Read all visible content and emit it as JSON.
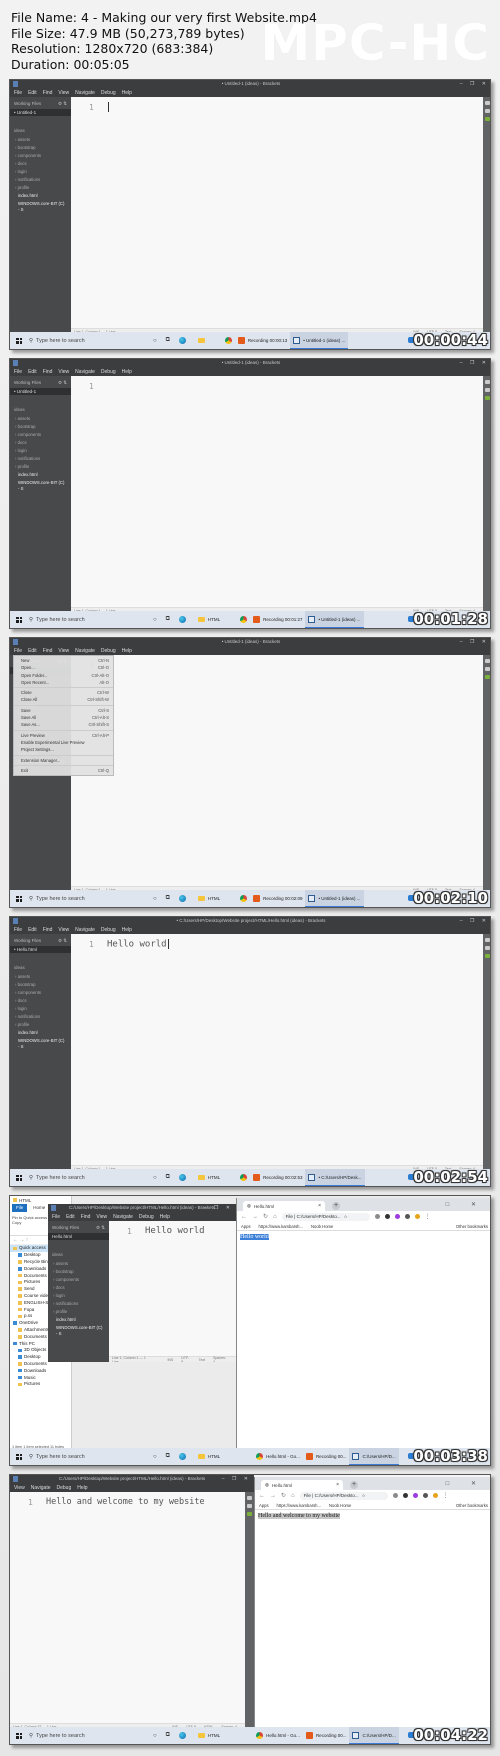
{
  "header": {
    "file_name": "File Name: 4 - Making our very first Website.mp4",
    "file_size": "File Size: 47.9 MB (50,273,789 bytes)",
    "resolution": "Resolution: 1280x720 (683:384)",
    "duration": "Duration: 00:05:05",
    "brand": "MPC-HC"
  },
  "common": {
    "menu": [
      "File",
      "Edit",
      "Find",
      "View",
      "Navigate",
      "Debug",
      "Help"
    ],
    "working_files": "Working Files",
    "folder": "ideas",
    "tree": [
      "assets",
      "bootstrap",
      "components",
      "docs",
      "login",
      "notifications",
      "profile"
    ],
    "tree_files": [
      "index.html",
      "WINDOWS.core-BIT (C) - S"
    ],
    "line_number": "1",
    "status_left": "Line 1, Column 1 — 1 Line",
    "status_right": [
      "INS",
      "UTF-8",
      "Text",
      "Spaces: 4"
    ],
    "taskbar_search": "Type here to search",
    "taskbar_folder": "HTML",
    "win_controls": "– ❐ ✕"
  },
  "frames": [
    {
      "timestamp": "00:00:44",
      "title": "• Untitled-1 (ideas) - Brackets",
      "active_file": "• Untitled-1",
      "code": "",
      "tasks": [
        "Recording 00:00:13",
        "• Untitled-1 (ideas) ..."
      ]
    },
    {
      "timestamp": "00:01:28",
      "title": "• Untitled-1 (ideas) - Brackets",
      "active_file": "• Untitled-1",
      "code": "",
      "tasks": [
        "Recording 00:01:27",
        "• Untitled-1 (ideas) ..."
      ]
    },
    {
      "timestamp": "00:02:10",
      "title": "• Untitled-1 (ideas) - Brackets",
      "active_file": "• Untitled-1",
      "code": "",
      "tasks": [
        "Recording 00:02:09",
        "• Untitled-1 (ideas) ..."
      ],
      "file_menu": [
        {
          "label": "New",
          "shortcut": "Ctrl-N"
        },
        {
          "label": "Open...",
          "shortcut": "Ctrl-O"
        },
        {
          "label": "Open Folder...",
          "shortcut": "Ctrl-Alt-O"
        },
        {
          "label": "Open Recent...",
          "shortcut": "Alt-O"
        },
        {
          "label": "Close",
          "shortcut": "Ctrl-W"
        },
        {
          "label": "Close All",
          "shortcut": "Ctrl-Shift-W"
        },
        {
          "label": "Save",
          "shortcut": "Ctrl-S"
        },
        {
          "label": "Save All",
          "shortcut": "Ctrl-Alt-S"
        },
        {
          "label": "Save As...",
          "shortcut": "Ctrl-Shift-S"
        },
        {
          "label": "Live Preview",
          "shortcut": "Ctrl-Alt-P"
        },
        {
          "label": "Enable Experimental Live Preview",
          "shortcut": ""
        },
        {
          "label": "Project Settings...",
          "shortcut": ""
        },
        {
          "label": "Extension Manager...",
          "shortcut": ""
        },
        {
          "label": "Exit",
          "shortcut": "Ctrl-Q"
        }
      ]
    },
    {
      "timestamp": "00:02:54",
      "title": "• C:/Users/HP/Desktop/Website project/HTML/Hello.html (ideas) - Brackets",
      "active_file": "• Hello.html",
      "code": "Hello world",
      "tasks": [
        "Recording 00:02:53",
        "• C:/Users/HP/Desk..."
      ]
    },
    {
      "timestamp": "00:03:38",
      "title": "C:/Users/HP/Desktop/Website project/HTML/Hello.html (ideas) - Brackets",
      "active_file": "Hello.html",
      "code": "Hello world",
      "tasks": [
        "Hello.html - Go...",
        "Recording 00...",
        "C:/Users/HP/D..."
      ],
      "explorer": {
        "title": "HTML",
        "tabs": [
          "File",
          "Home"
        ],
        "ribbon": [
          "Pin to Quick access",
          "Copy"
        ],
        "nav": "← → ↑",
        "items": [
          {
            "label": "Quick access",
            "icon": "star",
            "top": true,
            "selected": true
          },
          {
            "label": "Desktop",
            "icon": "blue"
          },
          {
            "label": "Recycle Bin",
            "icon": "grey"
          },
          {
            "label": "Downloads",
            "icon": "blue"
          },
          {
            "label": "Documents",
            "icon": "grey"
          },
          {
            "label": "Pictures",
            "icon": "grey"
          },
          {
            "label": "Send",
            "icon": "folder"
          },
          {
            "label": "Course videos",
            "icon": "folder"
          },
          {
            "label": "ENGLISH-S",
            "icon": "folder"
          },
          {
            "label": "Fopa",
            "icon": "folder"
          },
          {
            "label": "p.ss",
            "icon": "folder"
          },
          {
            "label": "OneDrive",
            "icon": "blue",
            "top": true
          },
          {
            "label": "Attachments",
            "icon": "folder"
          },
          {
            "label": "Documents",
            "icon": "folder"
          },
          {
            "label": "This PC",
            "icon": "blue",
            "top": true
          },
          {
            "label": "3D Objects",
            "icon": "blue"
          },
          {
            "label": "Desktop",
            "icon": "blue"
          },
          {
            "label": "Documents",
            "icon": "grey"
          },
          {
            "label": "Downloads",
            "icon": "blue"
          },
          {
            "label": "Music",
            "icon": "blue"
          },
          {
            "label": "Pictures",
            "icon": "grey"
          }
        ],
        "status": "1 item    1 item selected  11 bytes"
      },
      "browser": {
        "tab_title": "Hello.html",
        "address": "File | C:/Users/HP/Deskto...",
        "bookmarks": [
          "Apps",
          "https://www.kambarsh...",
          "Noob Home"
        ],
        "other_bookmarks": "Other bookmarks",
        "content": "Hello world"
      }
    },
    {
      "timestamp": "00:04:22",
      "title": "C:/Users/HP/Desktop/Website project/HTML/Hello.html (ideas) - Brackets",
      "menu_partial": [
        "View",
        "Navigate",
        "Debug",
        "Help"
      ],
      "code": "Hello and welcome to my website",
      "status_left": "Line 1, Column 32 — 1 Line",
      "status_right": [
        "INS",
        "UTF-8",
        "HTML",
        "Spaces: 4"
      ],
      "tasks": [
        "Hello.html - Go...",
        "Recording 00...",
        "C:/Users/HP/D..."
      ],
      "browser": {
        "tab_title": "Hello.html",
        "address": "File | C:/Users/HP/Deskto...",
        "bookmarks": [
          "Apps",
          "https://www.kambarsh...",
          "Noob Home"
        ],
        "other_bookmarks": "Other bookmarks",
        "content": "Hello and welcome to my website"
      }
    }
  ]
}
